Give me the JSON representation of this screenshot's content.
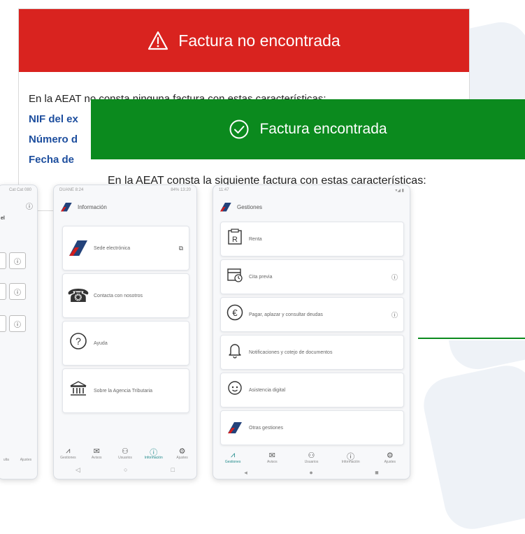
{
  "error_card": {
    "title": "Factura no encontrada",
    "intro": "En la AEAT no consta ninguna factura con estas características:",
    "fields": [
      "NIF del ex",
      "Número d",
      "Fecha de"
    ],
    "color": "#d9231f"
  },
  "success_card": {
    "title": "Factura encontrada",
    "intro": "En la AEAT consta la siguiente factura con estas características:",
    "color": "#0b8a1e"
  },
  "left_phone": {
    "status": "Cat Cat 080",
    "header_letter": "el",
    "info_icon": "ⓘ",
    "nav_labels": [
      "ulta",
      "Ajustes"
    ]
  },
  "mid_phone": {
    "status_left": "DUANE 8:24",
    "status_right": "84% 13:20",
    "header_title": "Información",
    "items": [
      {
        "icon": "aeat-logo",
        "label": "Sede electrónica",
        "side": "external-link-icon"
      },
      {
        "icon": "phone-icon",
        "label": "Contacta con nosotros"
      },
      {
        "icon": "help-icon",
        "label": "Ayuda"
      },
      {
        "icon": "institution-icon",
        "label": "Sobre la Agencia Tributaria"
      }
    ],
    "nav": [
      "Gestiones",
      "Avisos",
      "Usuarios",
      "Información",
      "Ajustes"
    ],
    "active_nav": "Información"
  },
  "right_phone": {
    "status_left": "11:47",
    "status_right": "▾◢ ▮",
    "header_title": "Gestiones",
    "items": [
      {
        "icon": "renta-icon",
        "label": "Renta"
      },
      {
        "icon": "calendar-icon",
        "label": "Cita previa",
        "help": true
      },
      {
        "icon": "euro-icon",
        "label": "Pagar, aplazar y consultar deudas",
        "help": true
      },
      {
        "icon": "bell-icon",
        "label": "Notificaciones y cotejo de documentos"
      },
      {
        "icon": "assistant-icon",
        "label": "Asistencia digital"
      },
      {
        "icon": "aeat-logo",
        "label": "Otras gestiones"
      }
    ],
    "nav": [
      "Gestiones",
      "Avisos",
      "Usuarios",
      "Información",
      "Ajustes"
    ],
    "active_nav": "Gestiones"
  }
}
